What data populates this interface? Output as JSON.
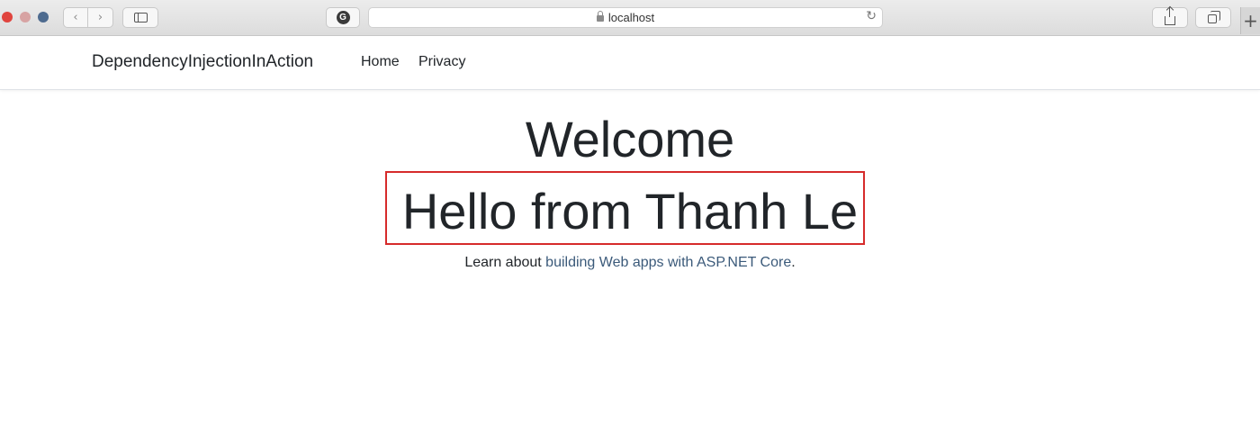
{
  "browser": {
    "address": "localhost",
    "icons": {
      "close": "red-circle",
      "minimize": "pink-circle",
      "maximize": "blue-circle",
      "back": "chevron-left-icon",
      "forward": "chevron-right-icon",
      "sidebar": "sidebar-icon",
      "extension": "g-extension-icon",
      "lock": "lock-icon",
      "reload": "reload-icon",
      "share": "share-icon",
      "tabs": "tabs-overview-icon",
      "new_tab": "plus-icon"
    },
    "glyphs": {
      "back": "‹",
      "forward": "›",
      "extension": "G",
      "reload": "↻",
      "new_tab": "+"
    }
  },
  "navbar": {
    "brand": "DependencyInjectionInAction",
    "links": [
      {
        "label": "Home"
      },
      {
        "label": "Privacy"
      }
    ]
  },
  "main": {
    "heading": "Welcome",
    "message": "Hello from Thanh Le",
    "learn_prefix": "Learn about ",
    "learn_link": "building Web apps with ASP.NET Core",
    "learn_suffix": "."
  },
  "colors": {
    "highlight_border": "#d62b2b",
    "link": "#3b5a7a",
    "text": "#212529"
  }
}
